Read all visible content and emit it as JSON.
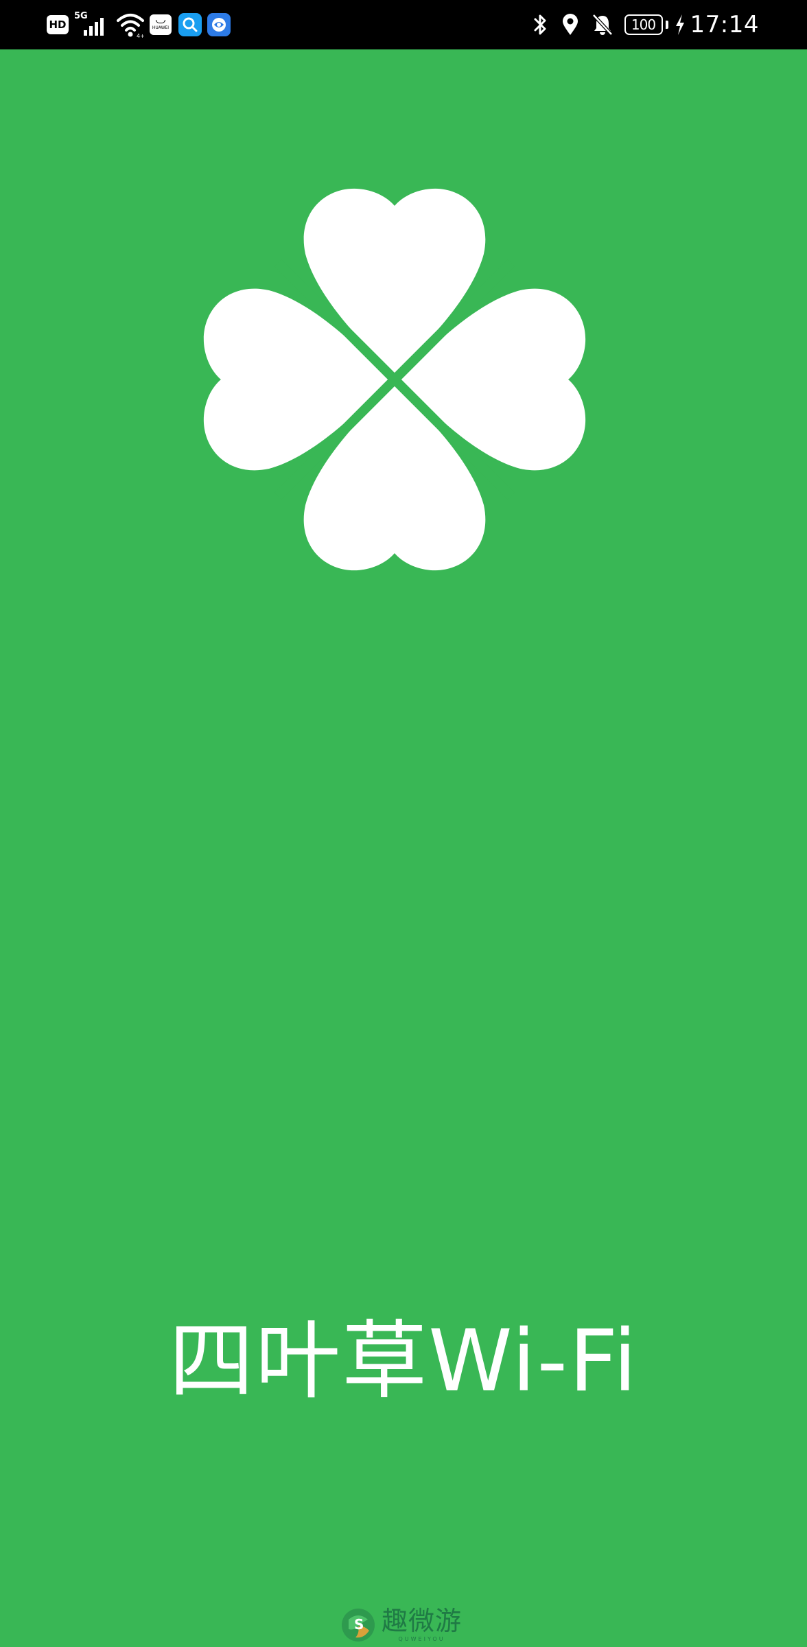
{
  "status_bar": {
    "hd_label": "HD",
    "network_label": "5G",
    "huawei_label": "HUAWEI",
    "battery_level": "100",
    "time": "17:14"
  },
  "splash": {
    "app_title": "四叶草Wi-Fi",
    "logo_icon": "four-leaf-clover-icon"
  },
  "watermark": {
    "name": "趣微游",
    "sub": "QUWEIYOU"
  },
  "colors": {
    "background": "#39b755",
    "logo": "#ffffff",
    "status_bar": "#000000"
  }
}
